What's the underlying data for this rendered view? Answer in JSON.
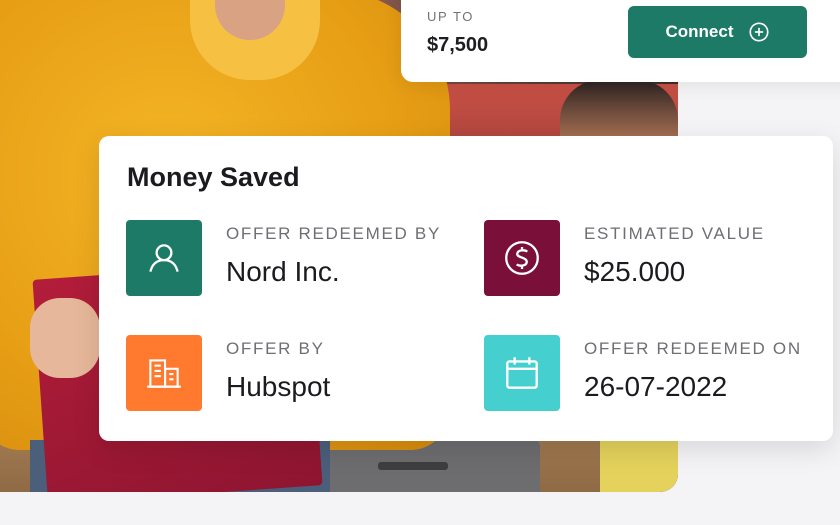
{
  "offer": {
    "upto_label": "UP TO",
    "upto_value": "$7,500",
    "connect_label": "Connect"
  },
  "summary": {
    "title": "Money Saved",
    "items": [
      {
        "label": "OFFER REDEEMED BY",
        "value": "Nord Inc.",
        "icon": "user-icon",
        "color": "#1d7a66"
      },
      {
        "label": "ESTIMATED VALUE",
        "value": "$25.000",
        "icon": "dollar-icon",
        "color": "#7a0f3a"
      },
      {
        "label": "OFFER BY",
        "value": "Hubspot",
        "icon": "building-icon",
        "color": "#ff7a2f"
      },
      {
        "label": "OFFER REDEEMED ON",
        "value": "26-07-2022",
        "icon": "calendar-icon",
        "color": "#46cfcf"
      }
    ]
  }
}
